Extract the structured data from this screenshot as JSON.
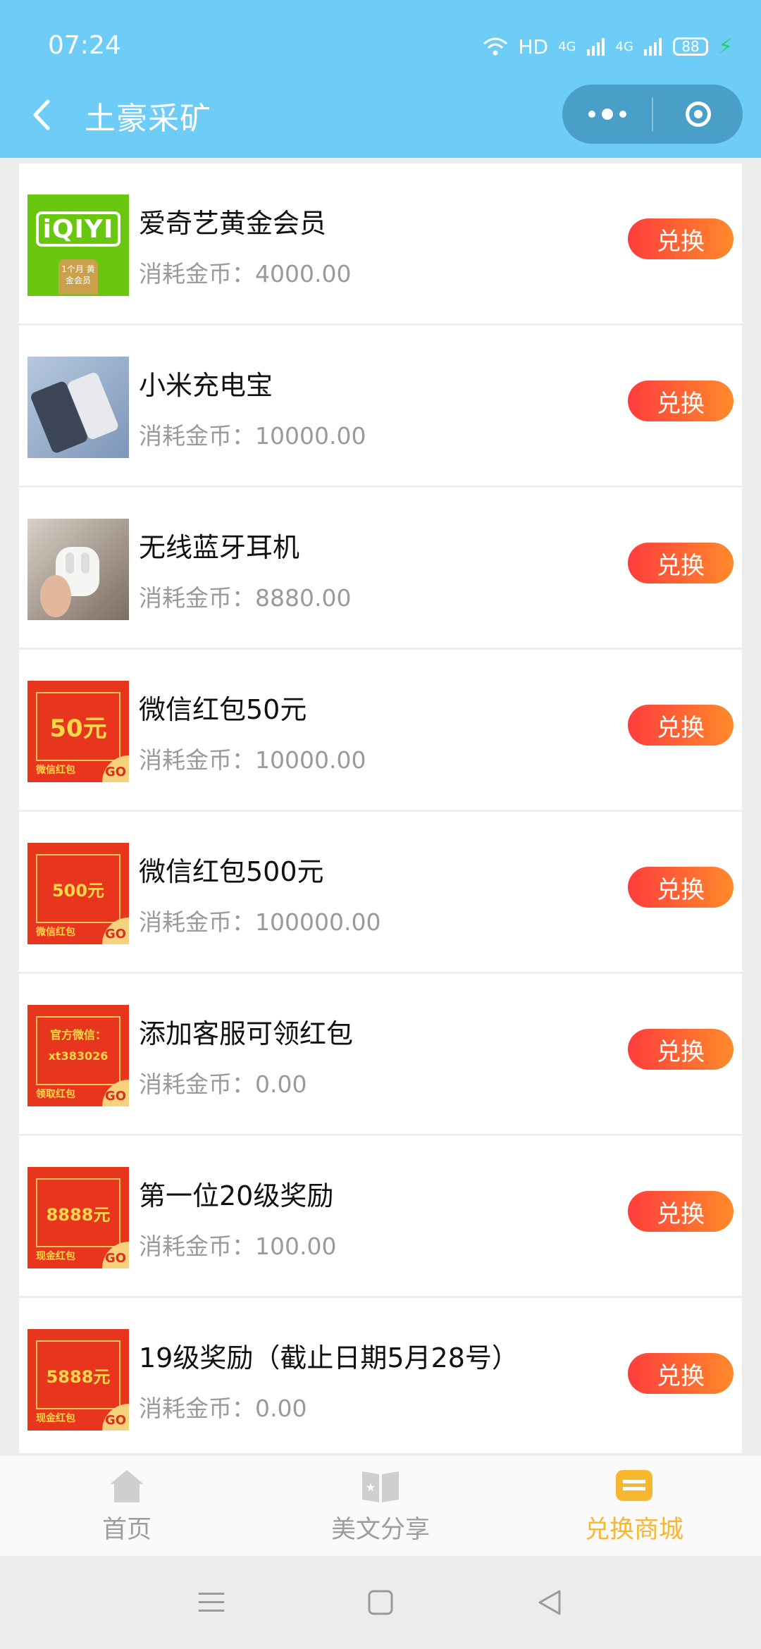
{
  "status_bar": {
    "time": "07:24",
    "network": "HD",
    "signal_1": "4G",
    "signal_2": "4G",
    "battery": "88"
  },
  "nav": {
    "title": "土豪采矿"
  },
  "items": [
    {
      "name": "爱奇艺黄金会员",
      "cost": "消耗金币：4000.00",
      "button": "兑换",
      "thumb": {
        "logo": "iQIYI",
        "sub": "1个月 黄金会员"
      }
    },
    {
      "name": "小米充电宝",
      "cost": "消耗金币：10000.00",
      "button": "兑换"
    },
    {
      "name": "无线蓝牙耳机",
      "cost": "消耗金币：8880.00",
      "button": "兑换"
    },
    {
      "name": "微信红包50元",
      "cost": "消耗金币：10000.00",
      "button": "兑换",
      "thumb": {
        "amount": "50元",
        "sub": "微信红包",
        "go": "GO"
      }
    },
    {
      "name": "微信红包500元",
      "cost": "消耗金币：100000.00",
      "button": "兑换",
      "thumb": {
        "amount": "500元",
        "sub": "微信红包",
        "go": "GO"
      }
    },
    {
      "name": "添加客服可领红包",
      "cost": "消耗金币：0.00",
      "button": "兑换",
      "thumb": {
        "amount": "官方微信：xt383026",
        "sub": "领取红包",
        "go": "GO"
      }
    },
    {
      "name": "第一位20级奖励",
      "cost": "消耗金币：100.00",
      "button": "兑换",
      "thumb": {
        "amount": "8888元",
        "sub": "现金红包",
        "go": "GO"
      }
    },
    {
      "name": "19级奖励（截止日期5月28号）",
      "cost": "消耗金币：0.00",
      "button": "兑换",
      "thumb": {
        "amount": "5888元",
        "sub": "现金红包",
        "go": "GO"
      }
    }
  ],
  "tabbar": [
    {
      "label": "首页",
      "icon": "home-icon",
      "active": false
    },
    {
      "label": "美文分享",
      "icon": "article-icon",
      "active": false
    },
    {
      "label": "兑换商城",
      "icon": "shop-icon",
      "active": true
    }
  ],
  "colors": {
    "header": "#6ecdf7",
    "button_start": "#ff3d3d",
    "button_end": "#ff8a2a",
    "active_tab": "#f7b72f"
  }
}
